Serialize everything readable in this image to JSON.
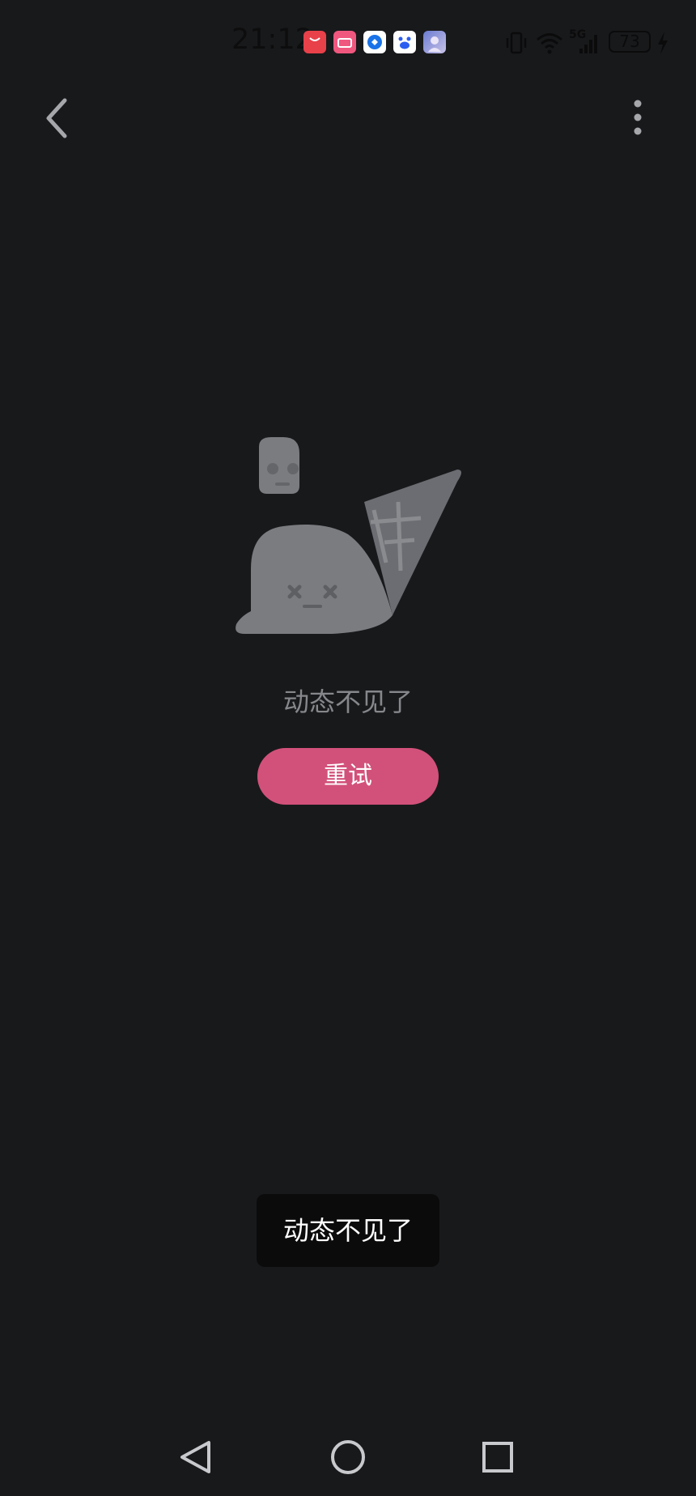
{
  "status_bar": {
    "time": "21:12",
    "battery": "73",
    "notifications": [
      "aliexpress-icon",
      "bilibili-icon",
      "app-icon",
      "baidu-icon",
      "avatar-icon"
    ],
    "indicators": [
      "vibrate-icon",
      "wifi-icon",
      "5g-signal-icon",
      "battery-icon",
      "charging-icon"
    ],
    "signal_label": "5G"
  },
  "header": {
    "back_icon": "chevron-left-icon",
    "more_icon": "more-vertical-icon"
  },
  "empty_state": {
    "message": "动态不见了",
    "retry_label": "重试",
    "illustration": "dropped-ice-cream-illustration"
  },
  "toast": {
    "text": "动态不见了"
  },
  "nav_bar": {
    "back_icon": "triangle-back-icon",
    "home_icon": "circle-home-icon",
    "recents_icon": "square-recents-icon"
  },
  "colors": {
    "background": "#18191b",
    "accent": "#d2517a",
    "illustration_gray": "#7b7c80",
    "message_gray": "#86878b",
    "toast_bg": "#0b0b0c"
  }
}
